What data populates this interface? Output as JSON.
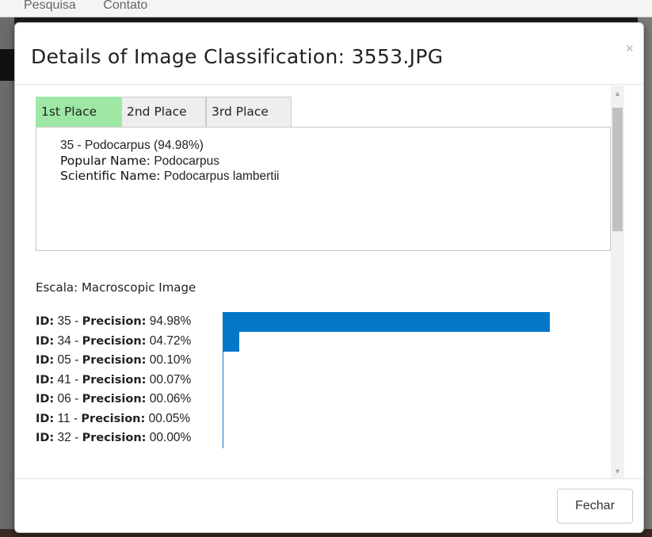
{
  "background_nav": {
    "items": [
      "Pesquisa",
      "Contato"
    ]
  },
  "modal": {
    "title": "Details of Image Classification: 3553.JPG",
    "close_symbol": "×",
    "tabs": [
      {
        "label": "1st Place",
        "active": true
      },
      {
        "label": "2nd Place",
        "active": false
      },
      {
        "label": "3rd Place",
        "active": false
      }
    ],
    "panel": {
      "heading": "35 - Podocarpus (94.98%)",
      "popular_label": "Popular Name:",
      "popular_value": "Podocarpus",
      "scientific_label": "Scientific Name:",
      "scientific_value": "Podocarpus lambertii"
    },
    "escala_label": "Escala:",
    "escala_value": "Macroscopic Image",
    "precision_rows": [
      {
        "id_label": "ID:",
        "id": "35",
        "precision_label": "Precision:",
        "value": "94.98%",
        "fraction": 0.9498
      },
      {
        "id_label": "ID:",
        "id": "34",
        "precision_label": "Precision:",
        "value": "04.72%",
        "fraction": 0.0472
      },
      {
        "id_label": "ID:",
        "id": "05",
        "precision_label": "Precision:",
        "value": "00.10%",
        "fraction": 0.001
      },
      {
        "id_label": "ID:",
        "id": "41",
        "precision_label": "Precision:",
        "value": "00.07%",
        "fraction": 0.0007
      },
      {
        "id_label": "ID:",
        "id": "06",
        "precision_label": "Precision:",
        "value": "00.06%",
        "fraction": 0.0006
      },
      {
        "id_label": "ID:",
        "id": "11",
        "precision_label": "Precision:",
        "value": "00.05%",
        "fraction": 0.0005
      },
      {
        "id_label": "ID:",
        "id": "32",
        "precision_label": "Precision:",
        "value": "00.00%",
        "fraction": 0.0
      }
    ],
    "footer_button": "Fechar"
  },
  "colors": {
    "active_tab": "#9ee8a5",
    "bar": "#0577c8"
  }
}
